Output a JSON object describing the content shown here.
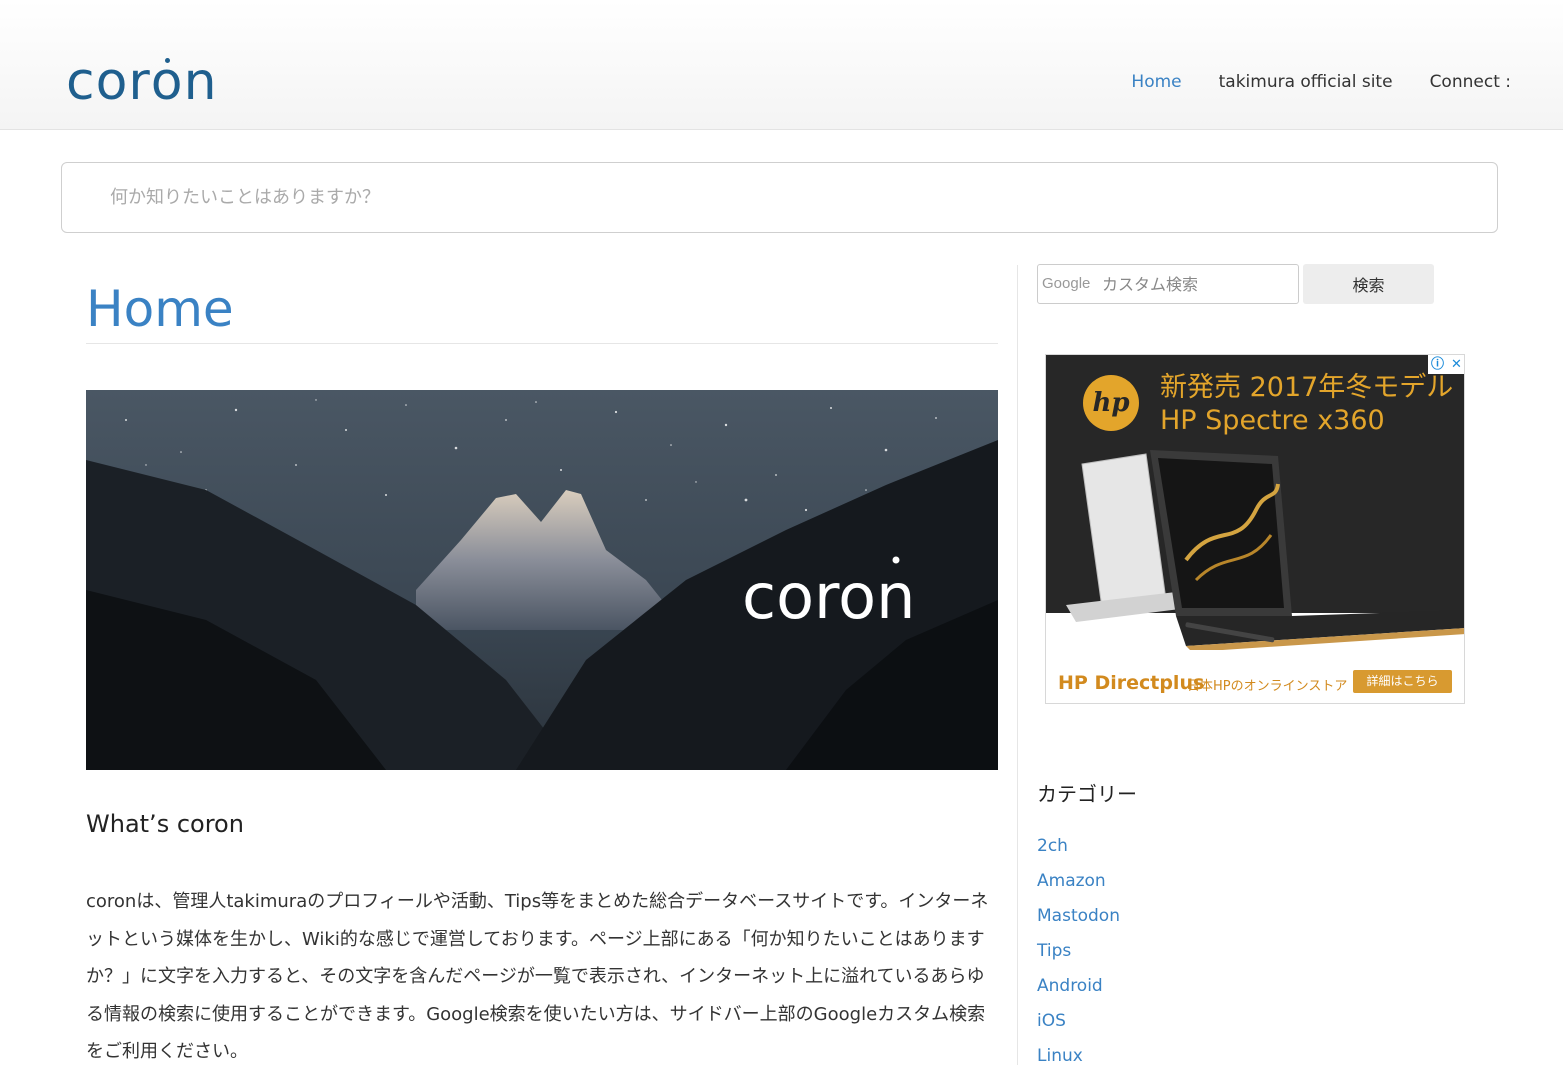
{
  "header": {
    "logo": "coron",
    "nav": [
      {
        "label": "Home",
        "active": true
      },
      {
        "label": "takimura official site",
        "active": false
      },
      {
        "label": "Connect :",
        "active": false
      }
    ]
  },
  "search": {
    "placeholder": "何か知りたいことはありますか？"
  },
  "main": {
    "title": "Home",
    "hero_text": "coron",
    "section_heading": "What’s coron",
    "body": "coronは、管理人takimuraのプロフィールや活動、Tips等をまとめた総合データベースサイトです。インターネットという媒体を生かし、Wiki的な感じで運営しております。ページ上部にある「何か知りたいことはありますか？」に文字を入力すると、その文字を含んだページが一覧で表示され、インターネット上に溢れているあらゆる情報の検索に使用することができます。Google検索を使いたい方は、サイドバー上部のGoogleカスタム検索をご利用ください。"
  },
  "sidebar": {
    "google_logo": "Google",
    "google_placeholder": "カスタム検索",
    "search_button": "検索",
    "ad": {
      "logo": "hp",
      "headline_1": "新発売 2017年冬モデル",
      "headline_2": "HP Spectre x360",
      "brand": "HP Directplus",
      "store": "日本HPのオンラインストア",
      "cta": "詳細はこちら",
      "info_icon": "ⓘ",
      "close_icon": "✕"
    },
    "categories_title": "カテゴリー",
    "categories": [
      "2ch",
      "Amazon",
      "Mastodon",
      "Tips",
      "Android",
      "iOS",
      "Linux"
    ]
  },
  "colors": {
    "accent": "#3a82c4",
    "logo": "#1f5f8e",
    "ad_gold": "#e3a52b"
  }
}
